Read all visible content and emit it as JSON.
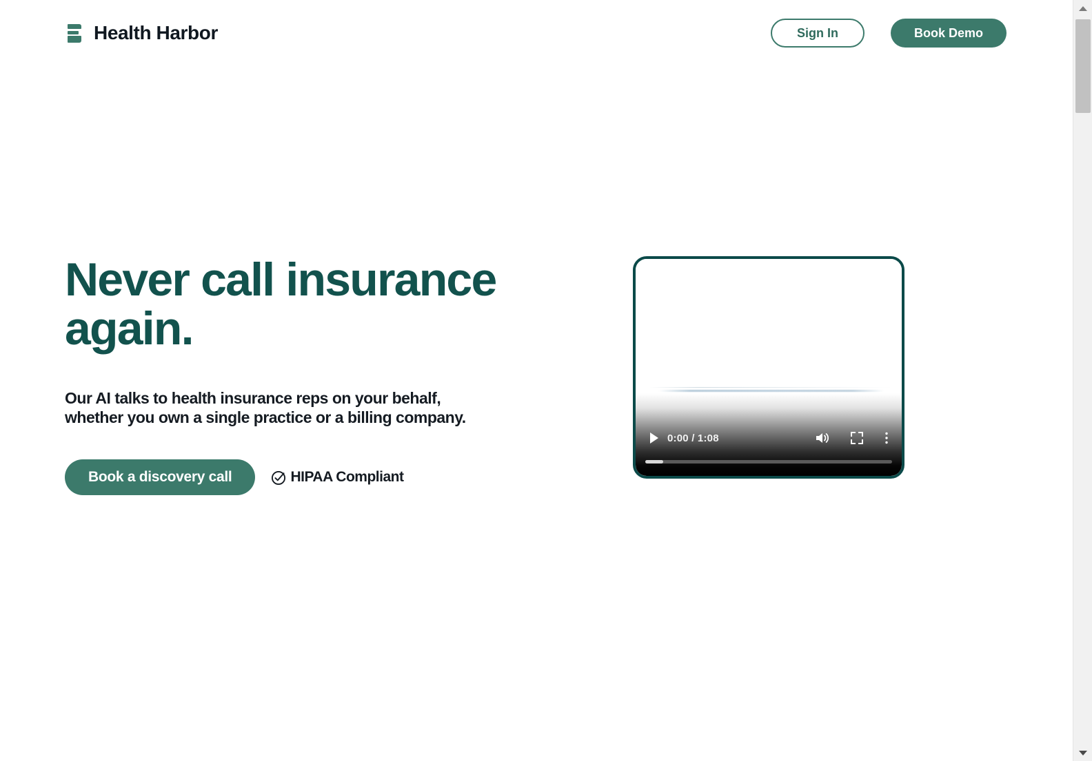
{
  "header": {
    "brand_name": "Health Harbor",
    "logo_icon": "harbor-mark-icon",
    "sign_in_label": "Sign In",
    "book_demo_label": "Book Demo"
  },
  "hero": {
    "title_line1": "Never call insurance",
    "title_line2": "again.",
    "subtitle_line1": "Our AI talks to health insurance reps on your behalf,",
    "subtitle_line2": "whether you own a single practice or a billing company.",
    "cta_label": "Book a discovery call",
    "badge_label": "HIPAA Compliant",
    "badge_icon": "circle-check-icon"
  },
  "video": {
    "play_icon": "play-icon",
    "time_display": "0:00 / 1:08",
    "current_time": "0:00",
    "duration": "1:08",
    "volume_icon": "volume-icon",
    "fullscreen_icon": "fullscreen-icon",
    "more_options_icon": "kebab-menu-icon",
    "progress_percent": 0
  },
  "scrollbar": {
    "up_icon": "scroll-up-arrow-icon",
    "down_icon": "scroll-down-arrow-icon"
  },
  "colors": {
    "brand_teal": "#3c7a6b",
    "deep_teal": "#12524d",
    "border_teal": "#0b4a49",
    "ink": "#151b22",
    "page_bg": "#ffffff"
  }
}
